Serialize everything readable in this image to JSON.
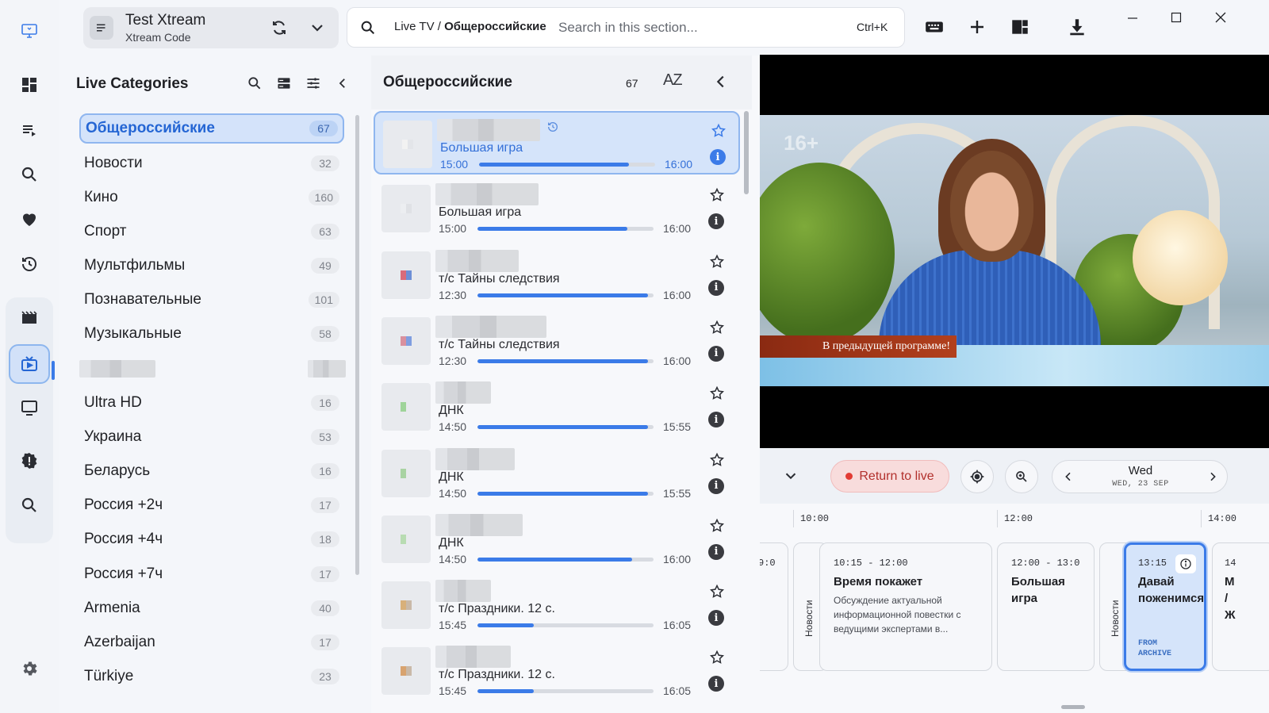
{
  "rail": {
    "items": [
      "dashboard-icon",
      "queue-icon",
      "search-icon",
      "heart-icon",
      "history-icon",
      "movies-icon",
      "live-tv-icon",
      "tv-icon",
      "alert-icon",
      "search-icon",
      "settings-icon"
    ]
  },
  "source": {
    "title": "Test Xtream",
    "subtitle": "Xtream Code"
  },
  "search": {
    "crumb_prefix": "Live TV / ",
    "crumb_current": "Общероссийские",
    "placeholder": "Search in this section...",
    "shortcut": "Ctrl+K"
  },
  "categories": {
    "title": "Live Categories",
    "items": [
      {
        "name": "Общероссийские",
        "count": "67",
        "active": true
      },
      {
        "name": "Новости",
        "count": "32"
      },
      {
        "name": "Кино",
        "count": "160"
      },
      {
        "name": "Спорт",
        "count": "63"
      },
      {
        "name": "Мультфильмы",
        "count": "49"
      },
      {
        "name": "Познавательные",
        "count": "101"
      },
      {
        "name": "Музыкальные",
        "count": "58"
      },
      {
        "name": "",
        "count": "",
        "blurred": true
      },
      {
        "name": "Ultra HD",
        "count": "16"
      },
      {
        "name": "Украина",
        "count": "53"
      },
      {
        "name": "Беларусь",
        "count": "16"
      },
      {
        "name": "Россия +2ч",
        "count": "17"
      },
      {
        "name": "Россия +4ч",
        "count": "18"
      },
      {
        "name": "Россия +7ч",
        "count": "17"
      },
      {
        "name": "Armenia",
        "count": "40"
      },
      {
        "name": "Azerbaijan",
        "count": "17"
      },
      {
        "name": "Türkiye",
        "count": "23"
      }
    ]
  },
  "channels": {
    "title": "Общероссийские",
    "count": "67",
    "sort_label": "AZ",
    "rows": [
      {
        "program": "Большая игра",
        "start": "15:00",
        "end": "16:00",
        "progress": 0.85,
        "active": true
      },
      {
        "program": "Большая игра",
        "start": "15:00",
        "end": "16:00",
        "progress": 0.85
      },
      {
        "program": "т/с Тайны следствия",
        "start": "12:30",
        "end": "16:00",
        "progress": 0.97
      },
      {
        "program": "т/с Тайны следствия",
        "start": "12:30",
        "end": "16:00",
        "progress": 0.97
      },
      {
        "program": "ДНК",
        "start": "14:50",
        "end": "15:55",
        "progress": 0.97
      },
      {
        "program": "ДНК",
        "start": "14:50",
        "end": "15:55",
        "progress": 0.97
      },
      {
        "program": "ДНК",
        "start": "14:50",
        "end": "16:00",
        "progress": 0.88
      },
      {
        "program": "т/с Праздники. 12 с.",
        "start": "15:45",
        "end": "16:05",
        "progress": 0.32
      },
      {
        "program": "т/с Праздники. 12 с.",
        "start": "15:45",
        "end": "16:05",
        "progress": 0.32
      }
    ]
  },
  "player": {
    "age_badge": "16+",
    "overlay_text": "В предыдущей программе!"
  },
  "epg": {
    "return_live": "Return to live",
    "day_name": "Wed",
    "day_date": "WED, 23 SEP",
    "time_labels": [
      "10:00",
      "12:00",
      "14:00"
    ],
    "cards": [
      {
        "time": "9:0",
        "title": "",
        "desc": ""
      },
      {
        "vertical": "Новости"
      },
      {
        "time": "10:15 - 12:00",
        "title": "Время покажет",
        "desc": "Обсуждение актуальной информационной повестки с ведущими экспертами в..."
      },
      {
        "time": "12:00 - 13:0",
        "title": "Большая игра",
        "desc": ""
      },
      {
        "vertical": "Новости"
      },
      {
        "time": "13:15",
        "title": "Давай поженимся!",
        "archive": "FROM ARCHIVE"
      },
      {
        "time": "14",
        "title": "М / Ж"
      }
    ]
  },
  "colors": {
    "accent": "#3b7be8",
    "live": "#e23b34"
  }
}
